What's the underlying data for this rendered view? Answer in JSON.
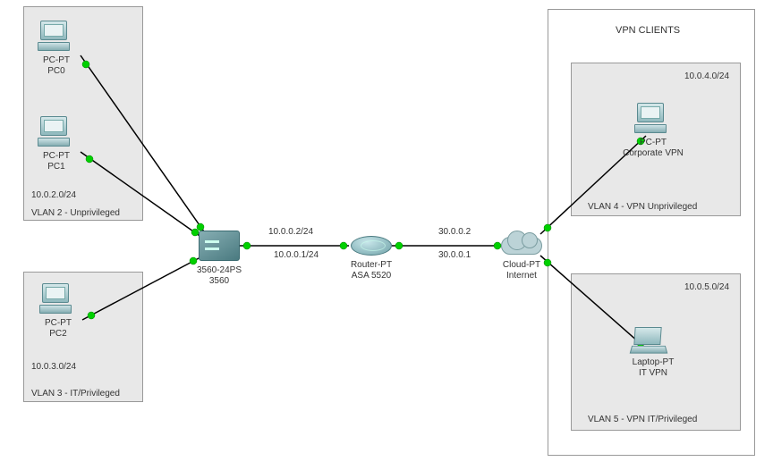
{
  "title_vpn_clients": "VPN CLIENTS",
  "groups": {
    "vlan2": {
      "label": "VLAN 2 - Unprivileged",
      "subnet": "10.0.2.0/24"
    },
    "vlan3": {
      "label": "VLAN 3 - IT/Privileged",
      "subnet": "10.0.3.0/24"
    },
    "vlan4": {
      "label": "VLAN 4 - VPN Unprivileged",
      "subnet": "10.0.4.0/24"
    },
    "vlan5": {
      "label": "VLAN 5 - VPN IT/Privileged",
      "subnet": "10.0.5.0/24"
    }
  },
  "devices": {
    "pc0": {
      "type": "PC-PT",
      "name": "PC0"
    },
    "pc1": {
      "type": "PC-PT",
      "name": "PC1"
    },
    "pc2": {
      "type": "PC-PT",
      "name": "PC2"
    },
    "switch": {
      "type": "3560-24PS",
      "name": "3560"
    },
    "router": {
      "type": "Router-PT",
      "name": "ASA 5520"
    },
    "cloud": {
      "type": "Cloud-PT",
      "name": "Internet"
    },
    "corpvpn": {
      "type": "PC-PT",
      "name": "Corporate VPN"
    },
    "itvpn": {
      "type": "Laptop-PT",
      "name": "IT VPN"
    }
  },
  "ips": {
    "sw_router_sw": "10.0.0.2/24",
    "sw_router_r": "10.0.0.1/24",
    "router_cloud_r": "30.0.0.2",
    "router_cloud_c": "30.0.0.1"
  }
}
